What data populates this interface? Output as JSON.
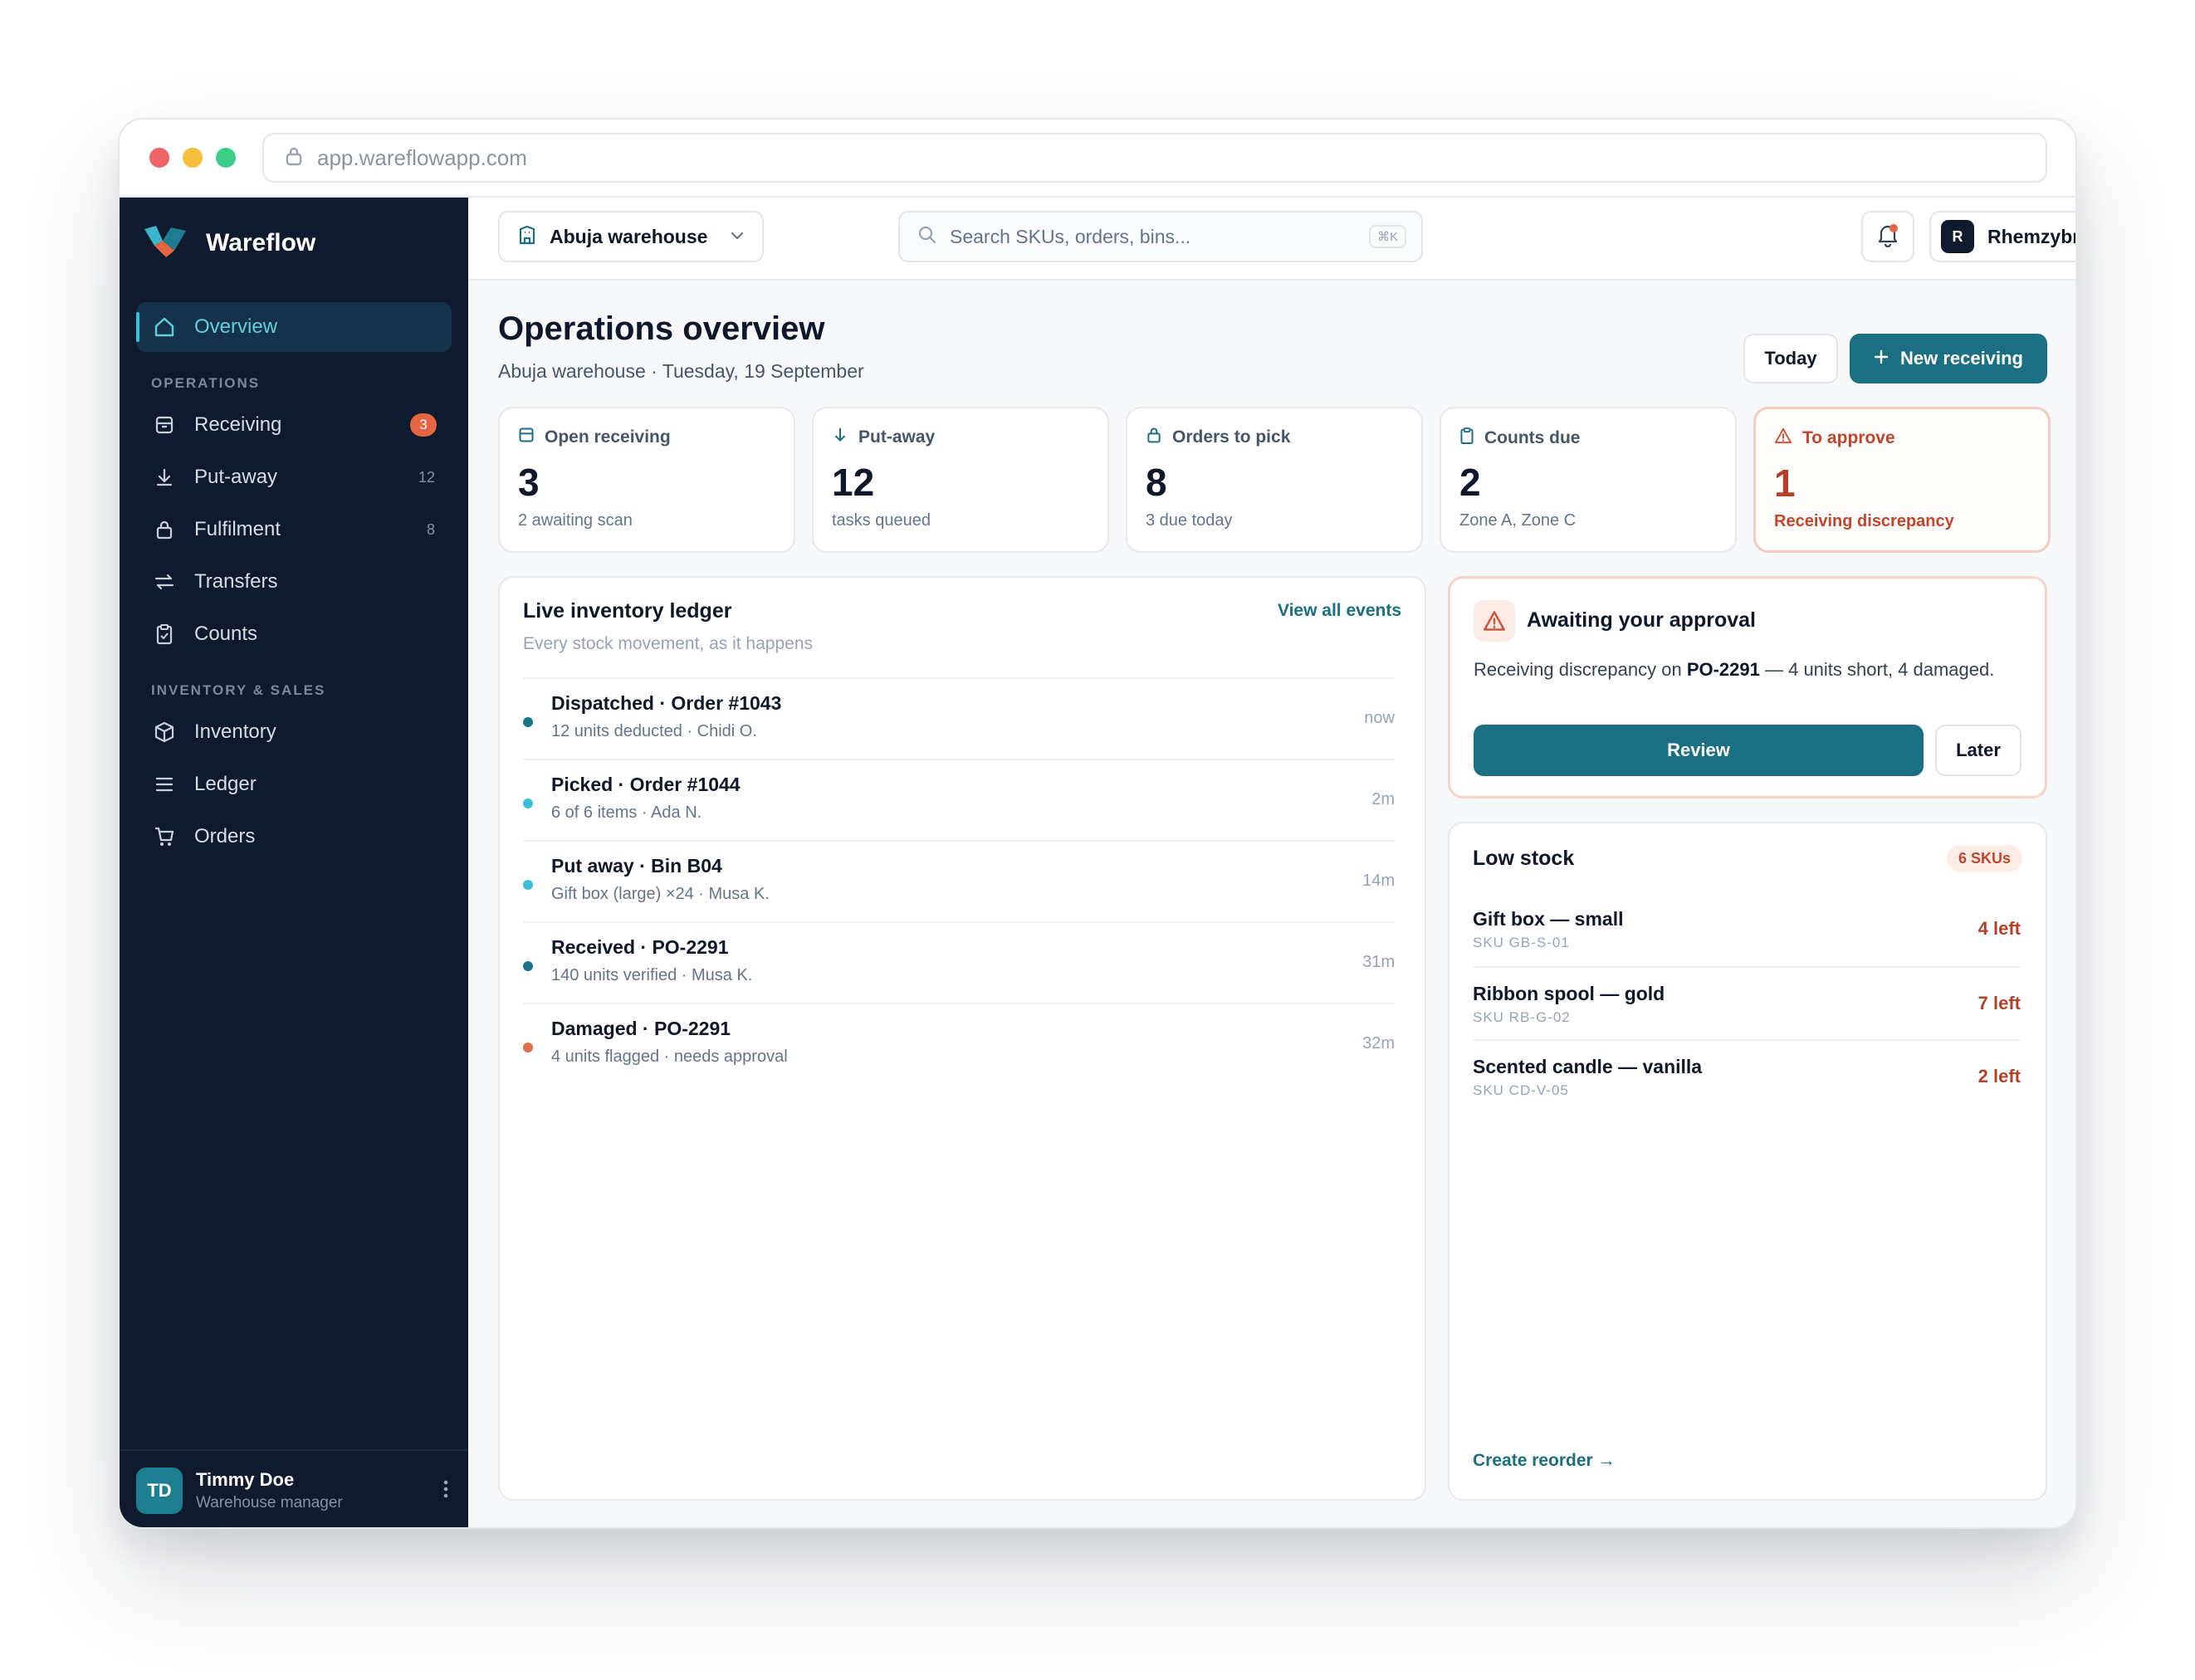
{
  "browser": {
    "url": "app.wareflowapp.com"
  },
  "sidebar": {
    "brand": "Wareflow",
    "active_item": "Overview",
    "sections": {
      "operations": "OPERATIONS",
      "inventory_sales": "INVENTORY & SALES"
    },
    "items": [
      {
        "label": "Overview",
        "icon": "home-icon"
      },
      {
        "label": "Receiving",
        "icon": "inbox-icon",
        "badge": "3"
      },
      {
        "label": "Put-away",
        "icon": "download-icon",
        "count": "12"
      },
      {
        "label": "Fulfilment",
        "icon": "bag-icon",
        "count": "8"
      },
      {
        "label": "Transfers",
        "icon": "transfer-icon"
      },
      {
        "label": "Counts",
        "icon": "clipboard-icon"
      },
      {
        "label": "Inventory",
        "icon": "box-icon"
      },
      {
        "label": "Ledger",
        "icon": "list-icon"
      },
      {
        "label": "Orders",
        "icon": "cart-icon"
      }
    ],
    "user": {
      "initials": "TD",
      "name": "Timmy Doe",
      "role": "Warehouse manager"
    }
  },
  "topbar": {
    "warehouse": "Abuja warehouse",
    "search_placeholder": "Search SKUs, orders, bins...",
    "search_shortcut": "⌘K",
    "account": {
      "initial": "R",
      "name": "Rhemzybrown"
    }
  },
  "header": {
    "title": "Operations overview",
    "subtitle": "Abuja warehouse · Tuesday, 19 September",
    "today_button": "Today",
    "new_receiving_button": "New receiving"
  },
  "stats": [
    {
      "label": "Open receiving",
      "value": "3",
      "sub": "2 awaiting scan",
      "icon": "inbox-icon"
    },
    {
      "label": "Put-away",
      "value": "12",
      "sub": "tasks queued",
      "icon": "arrow-down-icon"
    },
    {
      "label": "Orders to pick",
      "value": "8",
      "sub": "3 due today",
      "icon": "bag-icon"
    },
    {
      "label": "Counts due",
      "value": "2",
      "sub": "Zone A, Zone C",
      "icon": "clipboard-icon"
    },
    {
      "label": "To approve",
      "value": "1",
      "sub": "Receiving discrepancy",
      "icon": "warning-icon"
    }
  ],
  "ledger": {
    "title": "Live inventory ledger",
    "subtitle": "Every stock movement, as it happens",
    "view_all": "View all events",
    "events": [
      {
        "title": "Dispatched · Order #1043",
        "detail": "12 units deducted · Chidi O.",
        "time": "now",
        "color": "#1b7489"
      },
      {
        "title": "Picked · Order #1044",
        "detail": "6 of 6 items · Ada N.",
        "time": "2m",
        "color": "#3bbfd9"
      },
      {
        "title": "Put away · Bin B04",
        "detail": "Gift box (large) ×24 · Musa K.",
        "time": "14m",
        "color": "#3bbfd9"
      },
      {
        "title": "Received · PO-2291",
        "detail": "140 units verified · Musa K.",
        "time": "31m",
        "color": "#1b7489"
      },
      {
        "title": "Damaged · PO-2291",
        "detail": "4 units flagged · needs approval",
        "time": "32m",
        "color": "#e0704d"
      }
    ]
  },
  "approval": {
    "title": "Awaiting your approval",
    "text_before": "Receiving discrepancy on ",
    "po": "PO-2291",
    "text_after": " — 4 units short, 4 damaged.",
    "review": "Review",
    "later": "Later"
  },
  "low_stock": {
    "title": "Low stock",
    "badge": "6 SKUs",
    "items": [
      {
        "name": "Gift box — small",
        "sku": "SKU GB-S-01",
        "qty": "4 left"
      },
      {
        "name": "Ribbon spool — gold",
        "sku": "SKU RB-G-02",
        "qty": "7 left"
      },
      {
        "name": "Scented candle — vanilla",
        "sku": "SKU CD-V-05",
        "qty": "2 left"
      }
    ],
    "action": "Create reorder →"
  },
  "colors": {
    "sidebar": "#101a2e",
    "accent": "#1b6f82",
    "warning": "#c2452b"
  }
}
